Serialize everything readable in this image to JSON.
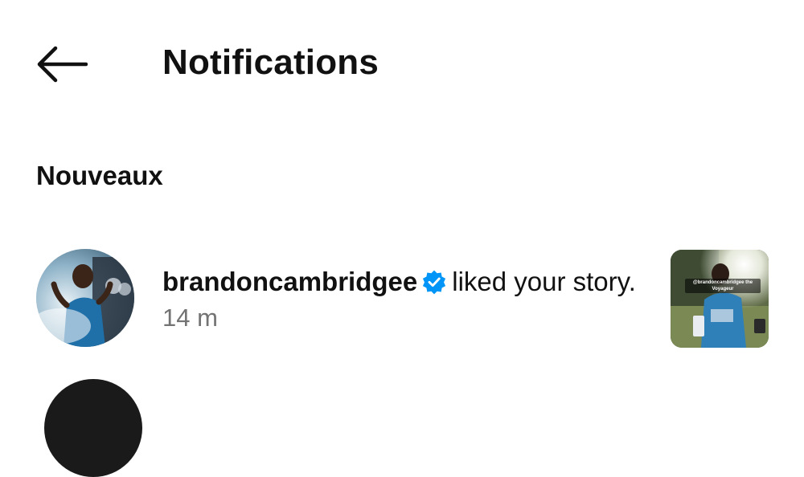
{
  "header": {
    "back_icon": "arrow-left-icon",
    "title": "Notifications"
  },
  "sections": [
    {
      "heading": "Nouveaux",
      "items": [
        {
          "username": "brandoncambridgee",
          "verified": true,
          "verified_icon": "verified-badge-icon",
          "verified_color": "#0095f6",
          "action": " liked your story.",
          "time": "14 m",
          "thumbnail_caption": "@brandoncambridgee the Voyageur"
        }
      ]
    }
  ]
}
